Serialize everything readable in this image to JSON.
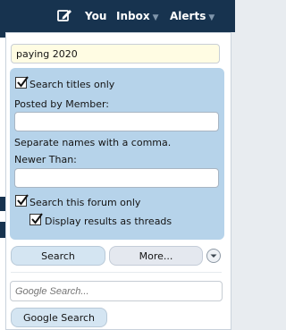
{
  "nav": {
    "compose_icon": "compose-icon",
    "you": "You",
    "inbox": "Inbox",
    "alerts": "Alerts",
    "caret": "▼"
  },
  "search": {
    "query": "paying 2020",
    "titles_only_label": "Search titles only",
    "titles_only_checked": true,
    "posted_by_label": "Posted by Member:",
    "posted_by_value": "",
    "separate_hint": "Separate names with a comma.",
    "newer_than_label": "Newer Than:",
    "newer_than_value": "",
    "this_forum_label": "Search this forum only",
    "this_forum_checked": true,
    "display_threads_label": "Display results as threads",
    "display_threads_checked": true,
    "search_button": "Search",
    "more_button": "More...",
    "google_placeholder": "Google Search...",
    "google_button": "Google Search"
  },
  "colors": {
    "topbar": "#17334f",
    "options_panel": "#b6d3ea",
    "query_bg": "#fffce3",
    "button_bg": "#d4e5f2"
  }
}
